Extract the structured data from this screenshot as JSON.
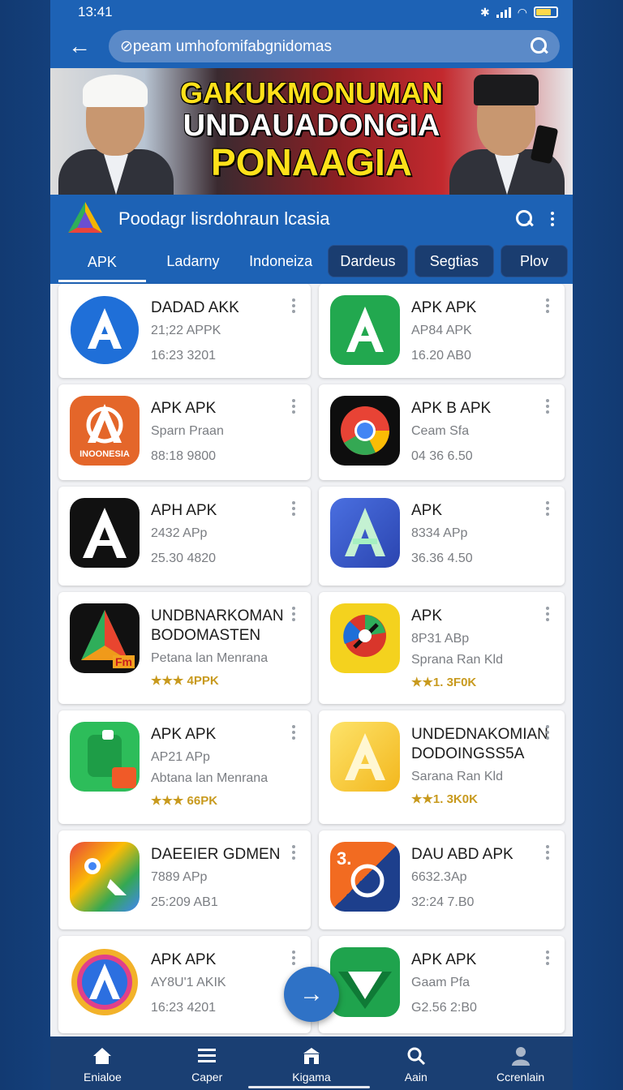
{
  "status_bar": {
    "time": "13:41"
  },
  "search": {
    "value": "⊘peam umhofomifabgnidomas"
  },
  "banner": {
    "line1": "GAKUKMONUMAN",
    "line2": "UNDAUADONGIA",
    "line3": "PONAAGIA"
  },
  "app_header": {
    "title": "Poodagr lisrdohraun lcasia"
  },
  "tabs": [
    {
      "label": "APK"
    },
    {
      "label": "Ladarny"
    },
    {
      "label": "Indoneiza"
    },
    {
      "label": "Dardeus"
    },
    {
      "label": "Segtias"
    },
    {
      "label": "Plov"
    }
  ],
  "apps": [
    {
      "name": "DADAD AKK",
      "sub": "21;22 APPK",
      "meta": "16:23 3201",
      "rating": ""
    },
    {
      "name": "APK APK",
      "sub": "AP84 APK",
      "meta": "16.20 AB0",
      "rating": ""
    },
    {
      "name": "APK APK",
      "sub": "Sparn Praan",
      "meta": "88:18 9800",
      "rating": "",
      "icon_text": "INOONESIA"
    },
    {
      "name": "APK B APK",
      "sub": "Ceam Sfa",
      "meta": "04 36 6.50",
      "rating": ""
    },
    {
      "name": "APH APK",
      "sub": "2432 APp",
      "meta": "25.30 4820",
      "rating": ""
    },
    {
      "name": "APK",
      "sub": "8334 APp",
      "meta": "36.36 4.50",
      "rating": ""
    },
    {
      "name": "UNDBNARKOMAN BODOMASTEN",
      "sub": "Petana lan Menrana",
      "meta": "",
      "rating": "★★★ 4PPK",
      "icon_text": "Fm"
    },
    {
      "name": "APK",
      "sub": "8P31 ABp",
      "meta": "",
      "rating": "★★1. 3F0K"
    },
    {
      "name": "APK APK",
      "sub": "AP21 APp",
      "meta": "",
      "rating": "★★★ 66PK",
      "sub2": "Abtana lan Menrana"
    },
    {
      "name": "UNDEDNAKOMIAN DODOINGSS5A",
      "sub": "Sarana Ran Kld",
      "meta": "",
      "rating": "★★1. 3K0K"
    },
    {
      "name": "DAEEIER GDMEN",
      "sub": "7889 APp",
      "meta": "25:209 AB1",
      "rating": ""
    },
    {
      "name": "DAU ABD APK",
      "sub": "6632.3Ap",
      "meta": "32:24 7.B0",
      "rating": "",
      "icon_text": "3."
    },
    {
      "name": "APK APK",
      "sub": "AY8U'1 AKIK",
      "meta": "16:23 4201",
      "rating": ""
    },
    {
      "name": "APK APK",
      "sub": "Gaam Pfa",
      "meta": "G2.56 2:B0",
      "rating": ""
    }
  ],
  "sub_row3": "Sprana Ran Kld",
  "fab": {
    "icon": "arrow-right-icon"
  },
  "bottom_nav": [
    {
      "label": "Enialoe",
      "icon": "home-icon"
    },
    {
      "label": "Caper",
      "icon": "list-icon"
    },
    {
      "label": "Kigama",
      "icon": "store-icon"
    },
    {
      "label": "Aain",
      "icon": "search-icon"
    },
    {
      "label": "Ccrenlain",
      "icon": "profile-icon"
    }
  ],
  "colors": {
    "primary": "#1d62b5",
    "nav": "#1a3f73",
    "rating": "#c89a1e"
  }
}
